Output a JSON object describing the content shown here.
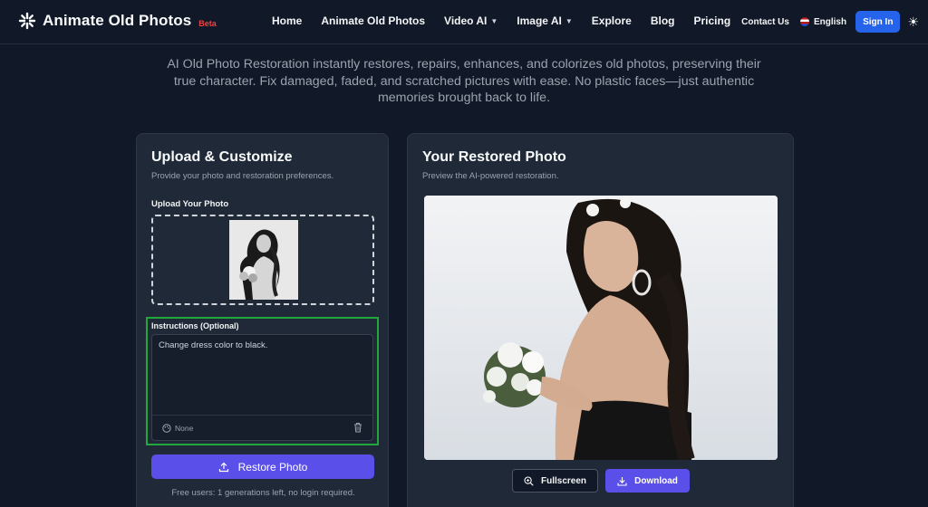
{
  "header": {
    "brand": "Animate Old Photos",
    "badge": "Beta",
    "nav": [
      {
        "label": "Home",
        "has_caret": false
      },
      {
        "label": "Animate Old Photos",
        "has_caret": false
      },
      {
        "label": "Video AI",
        "has_caret": true
      },
      {
        "label": "Image AI",
        "has_caret": true
      },
      {
        "label": "Explore",
        "has_caret": false
      },
      {
        "label": "Blog",
        "has_caret": false
      },
      {
        "label": "Pricing",
        "has_caret": false
      }
    ],
    "contact": "Contact Us",
    "language": "English",
    "signin": "Sign In",
    "theme_icon": "sun-icon"
  },
  "tagline": "AI Old Photo Restoration instantly restores, repairs, enhances, and colorizes old photos, preserving their true character. Fix damaged, faded, and scratched pictures with ease. No plastic faces—just authentic memories brought back to life.",
  "upload_panel": {
    "title": "Upload & Customize",
    "subtitle": "Provide your photo and restoration preferences.",
    "upload_label": "Upload Your Photo",
    "instructions_label": "Instructions (Optional)",
    "instructions_value": "Change dress color to black.",
    "style_value": "None",
    "restore_button": "Restore Photo",
    "free_note": "Free users: 1 generations left, no login required."
  },
  "result_panel": {
    "title": "Your Restored Photo",
    "subtitle": "Preview the AI-powered restoration.",
    "fullscreen_button": "Fullscreen",
    "download_button": "Download"
  },
  "colors": {
    "background": "#111827",
    "panel": "#1f2937",
    "accent": "#5b4fe9",
    "signin": "#2563eb",
    "highlight": "#22a83a",
    "beta": "#ef4444"
  }
}
